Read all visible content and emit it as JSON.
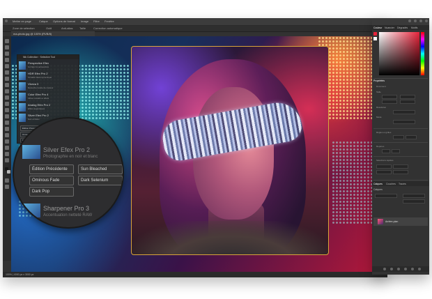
{
  "app": {
    "menu_items": [
      "Mettre en page",
      "Calque",
      "Options de format",
      "Image",
      "Filtre",
      "Fenêtre"
    ],
    "options_bar": [
      "Zone de sélection",
      "Outil",
      "Anti-alias",
      "Taille",
      "Correction automatique"
    ],
    "document_tab": "ma-photo.jpg @ 100% (RVB/8)",
    "status": "100% | 4000 px x 3000 px"
  },
  "effects_panel": {
    "header": "Nik Collection · Selective Tool",
    "items": [
      {
        "name": "Perspective Efex",
        "desc": "Corriger la perspective"
      },
      {
        "name": "HDR Efex Pro 2",
        "desc": "Tonalité haute dynamique"
      },
      {
        "name": "Viveza 3",
        "desc": "Retouche locale de couleur"
      },
      {
        "name": "Color Efex Pro 4",
        "desc": "Filtres créatifs et effets"
      },
      {
        "name": "Analog Efex Pro 2",
        "desc": "Effets argentiques"
      },
      {
        "name": "Silver Efex Pro 2",
        "desc": "Noir et blanc"
      }
    ],
    "mini_buttons": [
      "Édition Précédente",
      "Sun Bleached",
      "Ominous Fade",
      "Dark Selenium",
      "Dark Pop"
    ]
  },
  "magnifier": {
    "title_top": "Silver Efex Pro 2",
    "subtitle_top": "Photographie en noir et blanc",
    "buttons": [
      {
        "label": "Édition Précédente"
      },
      {
        "label": "Sun Bleached"
      },
      {
        "label": "Ominous Fade"
      },
      {
        "label": "Dark Selenium"
      },
      {
        "label": "Dark Pop"
      }
    ],
    "title_bottom": "Sharpener Pro 3",
    "subtitle_bottom": "Accentuation netteté RAW"
  },
  "right_panel": {
    "tabs": [
      "Couleur",
      "Nuancier",
      "Dégradés",
      "Motifs"
    ],
    "sections": [
      "Propriétés",
      "Calques"
    ],
    "properties": [
      {
        "label": "Document"
      },
      {
        "label": "Taille"
      },
      {
        "label": "Résolution"
      },
      {
        "label": "Mode"
      },
      {
        "label": "Règles et grilles"
      },
      {
        "label": "Repères"
      },
      {
        "label": "Sélections rapides"
      }
    ],
    "layers_tabs": [
      "Calques",
      "Couches",
      "Tracés"
    ],
    "layer_name": "Arrière-plan"
  },
  "colors": {
    "accent": "#d9a53a",
    "foreground_swatch": "#e8243b",
    "background_swatch": "#ffffff"
  }
}
